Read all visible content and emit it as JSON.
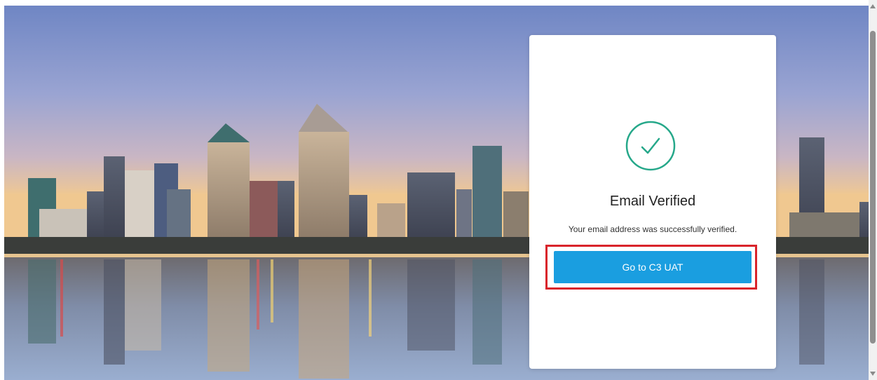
{
  "card": {
    "title": "Email Verified",
    "message": "Your email address was successfully verified.",
    "button_label": "Go to C3 UAT",
    "icon": "check-circle-icon"
  },
  "colors": {
    "accent": "#1a9ee0",
    "check": "#26a88a",
    "highlight": "#d9242b"
  }
}
